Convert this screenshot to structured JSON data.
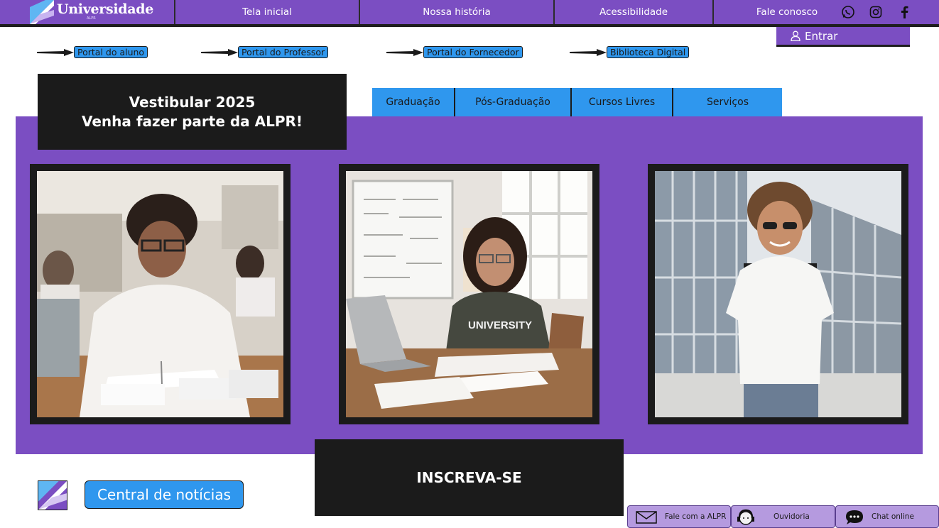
{
  "header": {
    "logo_text": "Universidade",
    "logo_sub": "ALPR",
    "nav": [
      "Tela inicial",
      "Nossa história",
      "Acessibilidade",
      "Fale conosco"
    ],
    "social_icons": [
      "whatsapp-icon",
      "instagram-icon",
      "facebook-icon"
    ]
  },
  "login": {
    "label": "Entrar"
  },
  "portals": [
    "Portal do aluno",
    "Portal do Professor",
    "Portal do Fornecedor",
    "Biblioteca Digital"
  ],
  "banner": {
    "line1": "Vestibular 2025",
    "line2": "Venha fazer parte da ALPR!"
  },
  "course_tabs": [
    "Graduação",
    "Pós-Graduação",
    "Cursos Livres",
    "Serviços"
  ],
  "cta": {
    "label": "INSCREVA-SE"
  },
  "news": {
    "label": "Central de notícias"
  },
  "footer_buttons": [
    "Fale com a ALPR",
    "Ouvidoria",
    "Chat online"
  ],
  "colors": {
    "purple": "#7b4ec2",
    "blue": "#2f97ee",
    "dark": "#1b1b1b",
    "lilac": "#b59adf"
  }
}
